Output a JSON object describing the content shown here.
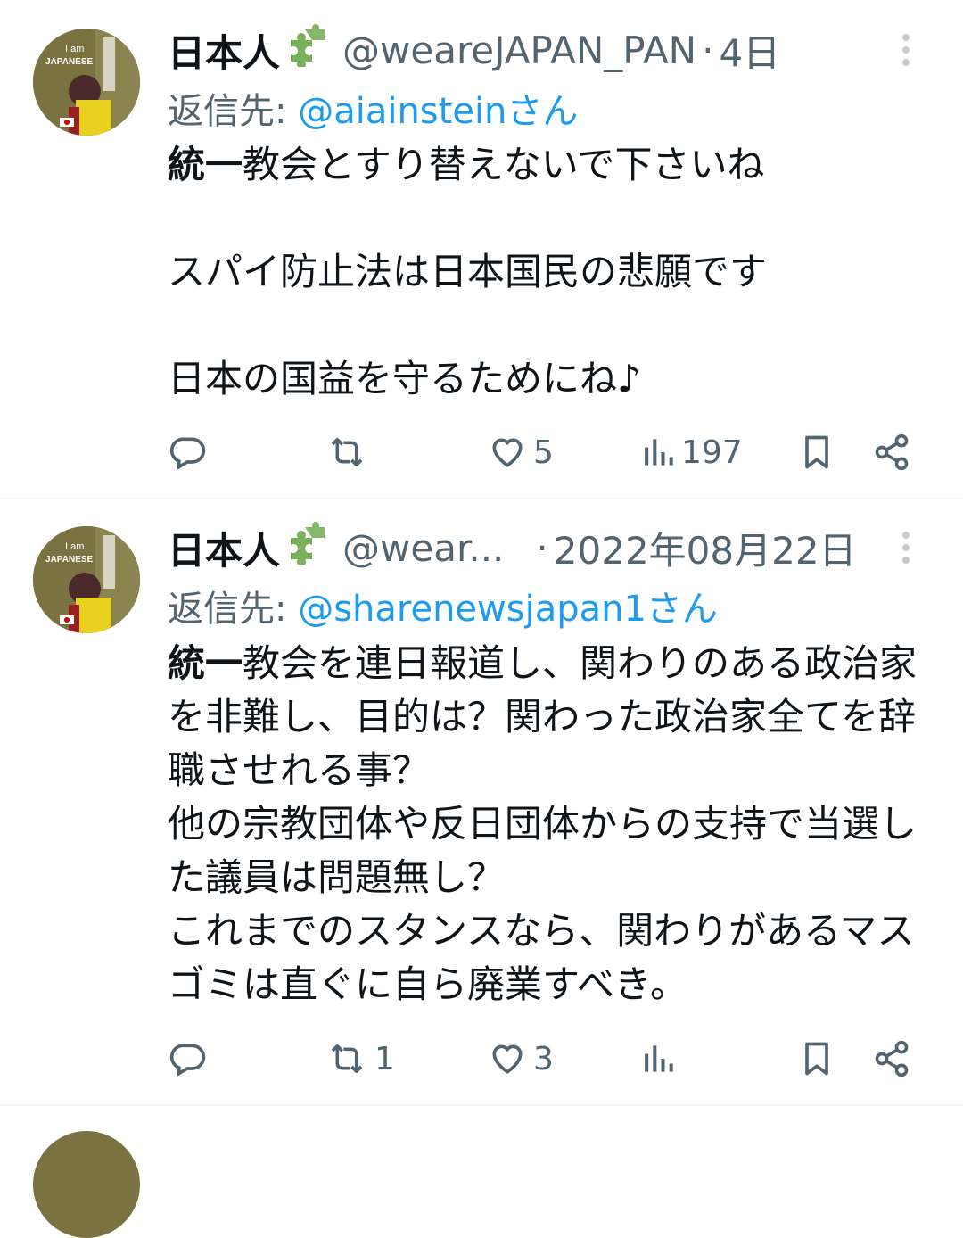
{
  "tweets": [
    {
      "name": "日本人",
      "handle": "@weareJAPAN_PAN",
      "dot": "·",
      "time": "4日",
      "reply_prefix": "返信先: ",
      "reply_handle": "@aiainsteinさん",
      "body_bold": "統一",
      "body_rest": "教会とすり替えないで下さいね\n\nスパイ防止法は日本国民の悲願です\n\n日本の国益を守るためにね♪",
      "counts": {
        "reply": "",
        "retweet": "",
        "like": "5",
        "views": "197"
      }
    },
    {
      "name": "日本人",
      "handle": "@wear...",
      "dot": "·",
      "time": "2022年08月22日",
      "reply_prefix": "返信先: ",
      "reply_handle": "@sharenewsjapan1さん",
      "body_bold": "統一",
      "body_rest": "教会を連日報道し、関わりのある政治家を非難し、目的は？関わった政治家全てを辞職させれる事？\n他の宗教団体や反日団体からの支持で当選した議員は問題無し？\nこれまでのスタンスなら、関わりがあるマスゴミは直ぐに自ら廃業すべき。",
      "counts": {
        "reply": "",
        "retweet": "1",
        "like": "3",
        "views": ""
      }
    }
  ],
  "avatar_text": [
    "I am",
    "JAPANESE"
  ],
  "colors": {
    "text": "#0f1419",
    "muted": "#536471",
    "link": "#1d9bf0",
    "divider": "#eff3f4",
    "puzzle": "#78b159"
  },
  "icons": [
    "avatar",
    "puzzle-icon",
    "more-icon",
    "reply-icon",
    "retweet-icon",
    "like-icon",
    "views-icon",
    "bookmark-icon",
    "share-icon"
  ]
}
